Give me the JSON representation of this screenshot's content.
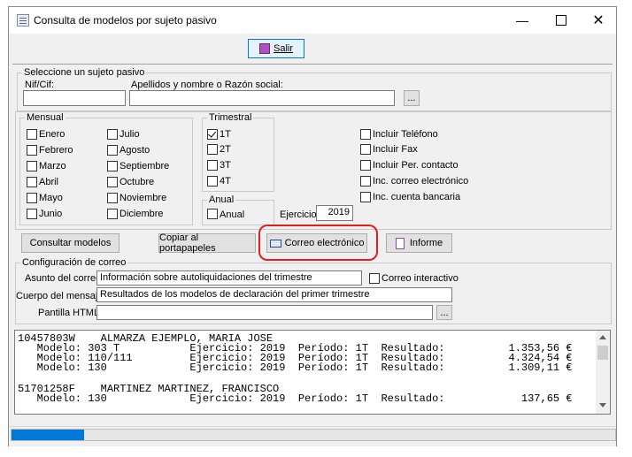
{
  "window": {
    "title": "Consulta de modelos por sujeto pasivo"
  },
  "toolbar": {
    "exit_label": "Salir"
  },
  "subject": {
    "group_title": "Seleccione un sujeto pasivo",
    "nif_label": "Nif/Cif:",
    "name_label": "Apellidos y nombre o Razón social:",
    "nif_value": "",
    "name_value": "",
    "browse_label": "..."
  },
  "monthly": {
    "title": "Mensual",
    "col1": [
      "Enero",
      "Febrero",
      "Marzo",
      "Abril",
      "Mayo",
      "Junio"
    ],
    "col2": [
      "Julio",
      "Agosto",
      "Septiembre",
      "Octubre",
      "Noviembre",
      "Diciembre"
    ]
  },
  "quarterly": {
    "title": "Trimestral",
    "items": [
      "1T",
      "2T",
      "3T",
      "4T"
    ],
    "checked": [
      "1T"
    ]
  },
  "annual": {
    "title": "Anual",
    "item": "Anual"
  },
  "exercise": {
    "label": "Ejercicio:",
    "value": "2019"
  },
  "options": [
    "Incluir Teléfono",
    "Incluir Fax",
    "Incluir Per. contacto",
    "Inc. correo electrónico",
    "Inc. cuenta bancaria"
  ],
  "actions": {
    "consult": "Consultar modelos",
    "copy": "Copiar al portapapeles",
    "email": "Correo electrónico",
    "report": "Informe"
  },
  "mail": {
    "group_title": "Configuración de correo",
    "subject_label": "Asunto del correo:",
    "subject_value": "Información sobre autoliquidaciones del trimestre",
    "interactive_label": "Correo interactivo",
    "body_label": "Cuerpo del mensaje:",
    "body_value": "Resultados de los modelos de declaración del primer trimestre",
    "template_label": "Pantilla HTML:",
    "template_value": "",
    "browse_label": "..."
  },
  "results": {
    "lines": [
      "10457803W    ALMARZA EJEMPLO, MARIA JOSE",
      "   Modelo: 303 T           Ejercicio: 2019  Período: 1T  Resultado:          1.353,56 €",
      "   Modelo: 110/111         Ejercicio: 2019  Período: 1T  Resultado:          4.324,54 €",
      "   Modelo: 130             Ejercicio: 2019  Período: 1T  Resultado:          1.309,11 €",
      "",
      "51701258F    MARTINEZ MARTINEZ, FRANCISCO",
      "   Modelo: 130             Ejercicio: 2019  Período: 1T  Resultado:            137,65 €"
    ]
  },
  "status": {
    "progress": 0.12
  }
}
